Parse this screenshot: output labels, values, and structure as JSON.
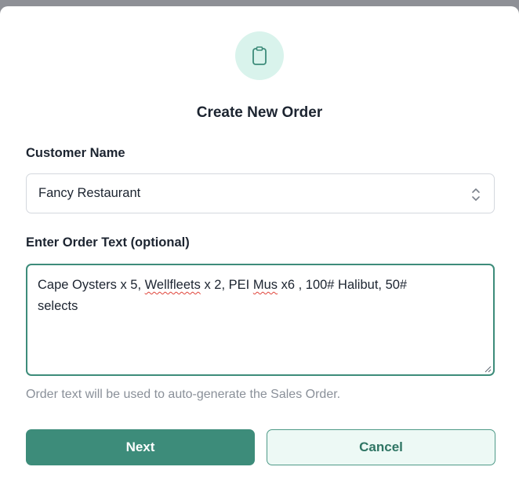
{
  "dialog": {
    "title": "Create New Order",
    "icon": "clipboard-icon"
  },
  "customer": {
    "label": "Customer Name",
    "selected_value": "Fancy Restaurant"
  },
  "order_text": {
    "label": "Enter Order Text (optional)",
    "segments": [
      "Cape Oysters x 5, ",
      "Wellfleets",
      " x 2, PEI ",
      "Mus",
      " x6 , 100# Halibut, 50#\nselects"
    ],
    "hint": "Order text will be used to auto-generate the Sales Order."
  },
  "buttons": {
    "next_label": "Next",
    "cancel_label": "Cancel"
  },
  "colors": {
    "accent": "#3d8c7a",
    "icon_bg": "#d9f3ec",
    "cancel_bg": "#edf9f5",
    "overlay": "#8e9096"
  }
}
